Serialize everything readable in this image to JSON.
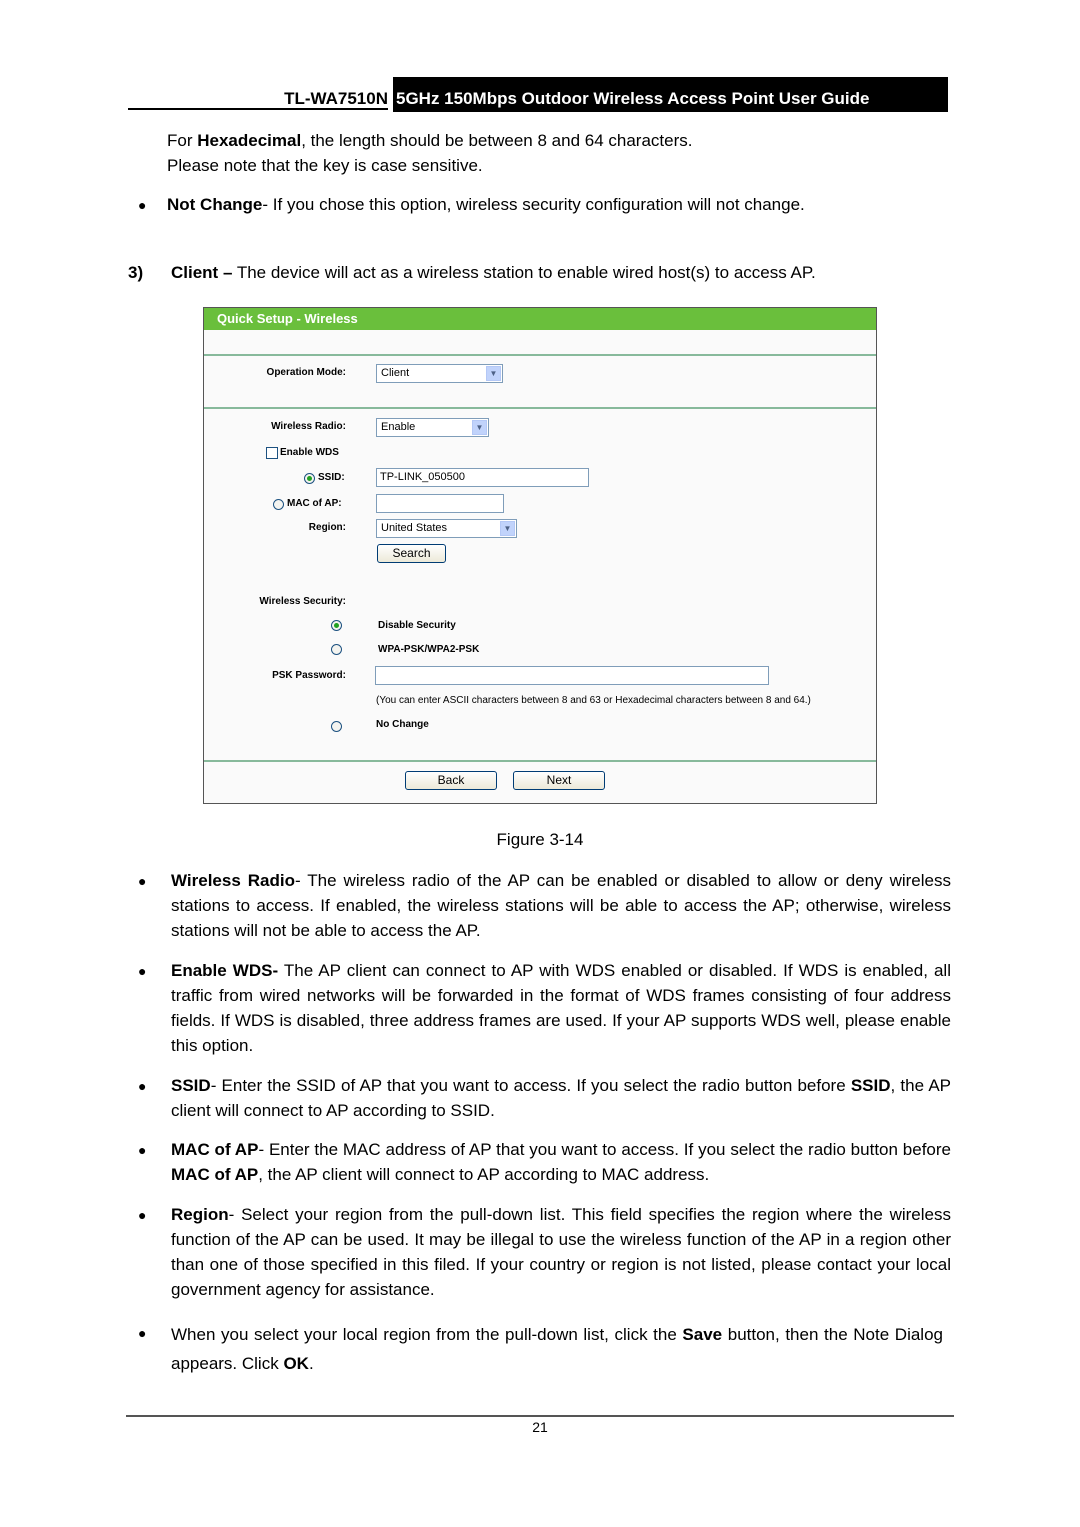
{
  "header": {
    "model": "TL-WA7510N",
    "guide_title": "5GHz 150Mbps Outdoor Wireless Access Point User Guide"
  },
  "intro": {
    "hex_prefix": "For ",
    "hex_bold": "Hexadecimal",
    "hex_rest": ", the length should be between 8 and 64 characters.",
    "case_note": "Please note that the key is case sensitive.",
    "not_change_bold": "Not Change",
    "not_change_rest": "- If you chose this option, wireless security configuration will not change."
  },
  "section": {
    "number": "3)",
    "title_bold": "Client –",
    "title_rest": " The device will act as a wireless station to enable wired host(s) to access AP."
  },
  "figure": {
    "panel_title": "Quick Setup - Wireless",
    "operation_mode_label": "Operation Mode:",
    "operation_mode_value": "Client",
    "wireless_radio_label": "Wireless Radio:",
    "wireless_radio_value": "Enable",
    "enable_wds_label": "Enable WDS",
    "enable_wds_checked": false,
    "ssid_label": "SSID:",
    "ssid_value": "TP-LINK_050500",
    "ssid_selected": true,
    "mac_label": "MAC of AP:",
    "mac_value": "",
    "region_label": "Region:",
    "region_value": "United States",
    "search_button": "Search",
    "wireless_security_label": "Wireless Security:",
    "security_options": [
      {
        "label": "Disable Security",
        "selected": true
      },
      {
        "label": "WPA-PSK/WPA2-PSK",
        "selected": false
      },
      {
        "label": "No Change",
        "selected": false
      }
    ],
    "psk_label": "PSK Password:",
    "psk_value": "",
    "psk_hint": "(You can enter ASCII characters between 8 and 63 or Hexadecimal characters between 8 and 64.)",
    "back_button": "Back",
    "next_button": "Next",
    "caption": "Figure 3-14",
    "header_color": "#6abf3c"
  },
  "bullets": {
    "wireless_radio": {
      "bold": "Wireless Radio",
      "rest": "- The wireless radio of the AP can be enabled or disabled to allow or deny wireless stations to access. If enabled, the wireless stations will be able to access the AP; otherwise, wireless stations will not be able to access the AP."
    },
    "enable_wds": {
      "bold": "Enable WDS-",
      "rest": " The AP client can connect to AP with WDS enabled or disabled. If WDS is enabled, all traffic from wired networks will be forwarded in the format of WDS frames consisting of four address fields. If WDS is disabled, three address frames are used. If your AP supports WDS well, please enable this option."
    },
    "ssid": {
      "bold": "SSID",
      "rest1": "- Enter the SSID of AP that you want to access. If you select the radio button before ",
      "bold2": "SSID",
      "rest2": ", the AP client will connect to AP according to SSID."
    },
    "mac": {
      "bold": "MAC of AP",
      "rest1": "- Enter the MAC address of AP that you want to access. If you select the radio button before ",
      "bold2": "MAC of AP",
      "rest2": ", the AP client will connect to AP according to MAC address."
    },
    "region": {
      "bold": "Region",
      "rest": "- Select your region from the pull-down list. This field specifies the region where the wireless function of the AP can be used. It may be illegal to use the wireless function of the AP in a region other than one of those specified in this filed. If your country or region is not listed, please contact your local government agency for assistance."
    },
    "save": {
      "rest1": "When you select your local region from the pull-down list, click the ",
      "bold": "Save",
      "rest2": " button, then the Note Dialog appears. Click ",
      "bold2": "OK",
      "rest3": "."
    }
  },
  "footer": {
    "page_number": "21"
  }
}
